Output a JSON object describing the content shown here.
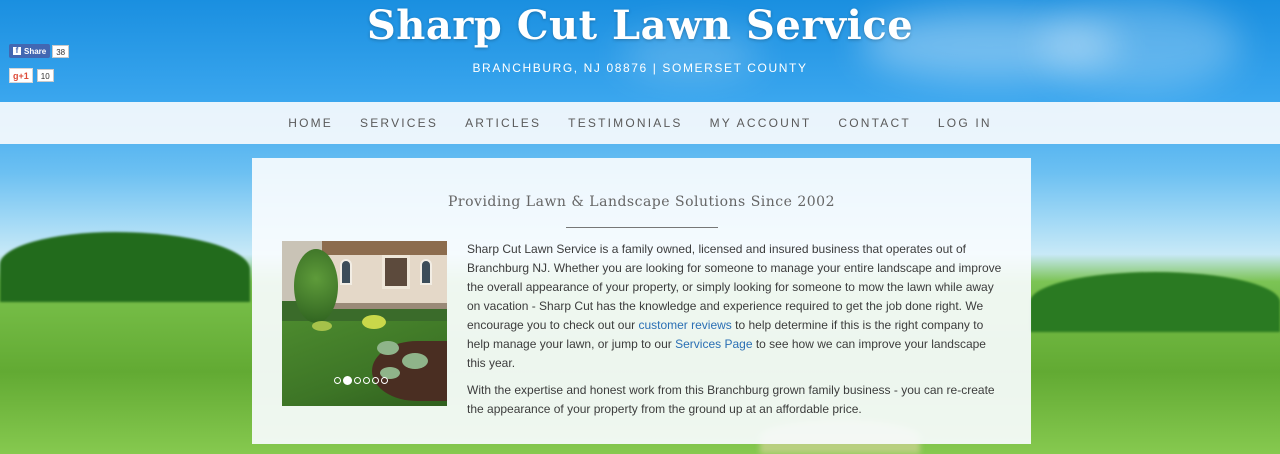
{
  "social": {
    "facebook": {
      "label": "Share",
      "count": "38"
    },
    "googleplus": {
      "label": "g+1",
      "count": "10"
    }
  },
  "header": {
    "title": "Sharp Cut Lawn Service",
    "subtitle": "BRANCHBURG, NJ 08876 | SOMERSET COUNTY"
  },
  "nav": {
    "items": [
      {
        "label": "HOME"
      },
      {
        "label": "SERVICES"
      },
      {
        "label": "ARTICLES"
      },
      {
        "label": "TESTIMONIALS"
      },
      {
        "label": "MY ACCOUNT"
      },
      {
        "label": "CONTACT"
      },
      {
        "label": "LOG IN"
      }
    ]
  },
  "main": {
    "tagline": "Providing Lawn & Landscape Solutions Since 2002",
    "slider": {
      "slides": 6,
      "active_slide": 2
    },
    "paragraph1": {
      "part1": "Sharp Cut Lawn Service is a family owned, licensed and insured business that operates out of Branchburg NJ. Whether you are looking for someone to manage your entire landscape and improve the overall appearance of your property, or simply looking for someone to mow the lawn while away on vacation - Sharp Cut has the knowledge and experience required to get the job done right. We encourage you to check out our ",
      "link1": "customer reviews",
      "part2": " to help determine if this is the right company to help manage your lawn, or jump to our ",
      "link2": "Services Page",
      "part3": " to see how we can improve your landscape this year."
    },
    "paragraph2": "With the expertise and honest work from this Branchburg grown family business - you can re-create the appearance of your property from the ground up at an affordable price."
  },
  "colors": {
    "link": "#2a6fb4",
    "facebook": "#4267b2",
    "googleplus": "#dd4b39"
  }
}
